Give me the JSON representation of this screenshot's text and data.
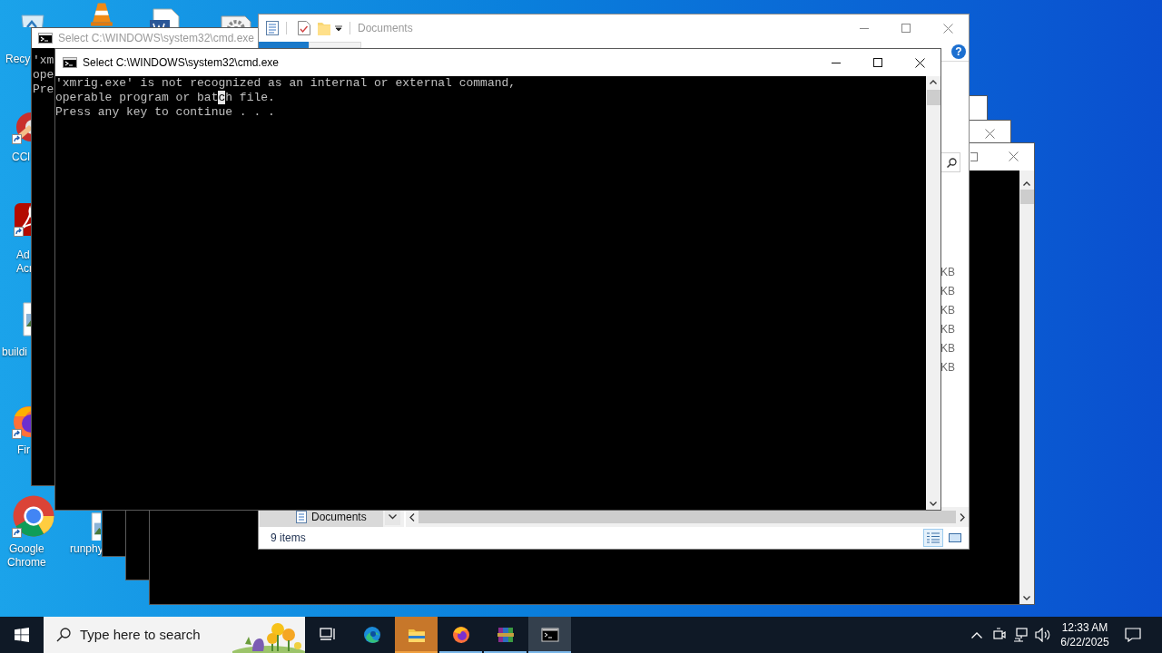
{
  "desktop_icons": [
    {
      "kind": "recycle-bin",
      "shortcut": false,
      "label_lines": [
        "Recy"
      ]
    },
    {
      "kind": "cone",
      "shortcut": false
    },
    {
      "kind": "document",
      "shortcut": false
    },
    {
      "kind": "settings-doc",
      "shortcut": false
    },
    {
      "kind": "cleaner",
      "shortcut": true,
      "label_lines": [
        "CCl"
      ]
    },
    {
      "kind": "pdf-reader",
      "shortcut": true,
      "label_lines": [
        "Ad",
        "Acr"
      ]
    },
    {
      "kind": "image-file",
      "shortcut": false,
      "label_lines": [
        "buildi"
      ]
    },
    {
      "kind": "browser-fox",
      "shortcut": true,
      "label_lines": [
        "Fir"
      ]
    },
    {
      "kind": "browser-ring",
      "shortcut": true,
      "label_lines": [
        "Google",
        "Chrome"
      ]
    },
    {
      "kind": "image-file",
      "shortcut": false,
      "label_lines": [
        "runphy"
      ]
    }
  ],
  "console_back": {
    "title": "Select C:\\WINDOWS\\system32\\cmd.exe",
    "active": false,
    "lines": [
      "'xm",
      "ope",
      "Pre"
    ]
  },
  "explorer": {
    "title": "Documents",
    "active": false,
    "help_glyph": "?",
    "size_column": [
      "KB",
      "KB",
      "KB",
      "KB",
      "KB",
      "KB"
    ],
    "nav_item": "Documents",
    "status": "9 items",
    "view_buttons": [
      {
        "kind": "details",
        "selected": true
      },
      {
        "kind": "large-icons",
        "selected": false
      }
    ]
  },
  "console_front": {
    "title": "Select C:\\WINDOWS\\system32\\cmd.exe",
    "active": true,
    "lines": [
      {
        "text": "'xmrig.exe' is not recognized as an internal or external command,"
      },
      {
        "text": "operable program or bat",
        "cursor": "c",
        "after": "h file."
      },
      {
        "text": "Press any key to continue . . ."
      }
    ]
  },
  "taskbar": {
    "search_placeholder": "Type here to search",
    "apps": [
      {
        "kind": "task-view",
        "running": false,
        "selected": false,
        "flashing": false
      },
      {
        "kind": "edge",
        "running": false,
        "selected": false,
        "flashing": false
      },
      {
        "kind": "file-explorer",
        "running": true,
        "selected": false,
        "flashing": true
      },
      {
        "kind": "firefox",
        "running": true,
        "selected": false,
        "flashing": false
      },
      {
        "kind": "archive",
        "running": true,
        "selected": false,
        "flashing": false
      },
      {
        "kind": "console",
        "running": true,
        "selected": true,
        "flashing": false
      }
    ],
    "time": "12:33 AM",
    "date": "6/22/2025"
  }
}
